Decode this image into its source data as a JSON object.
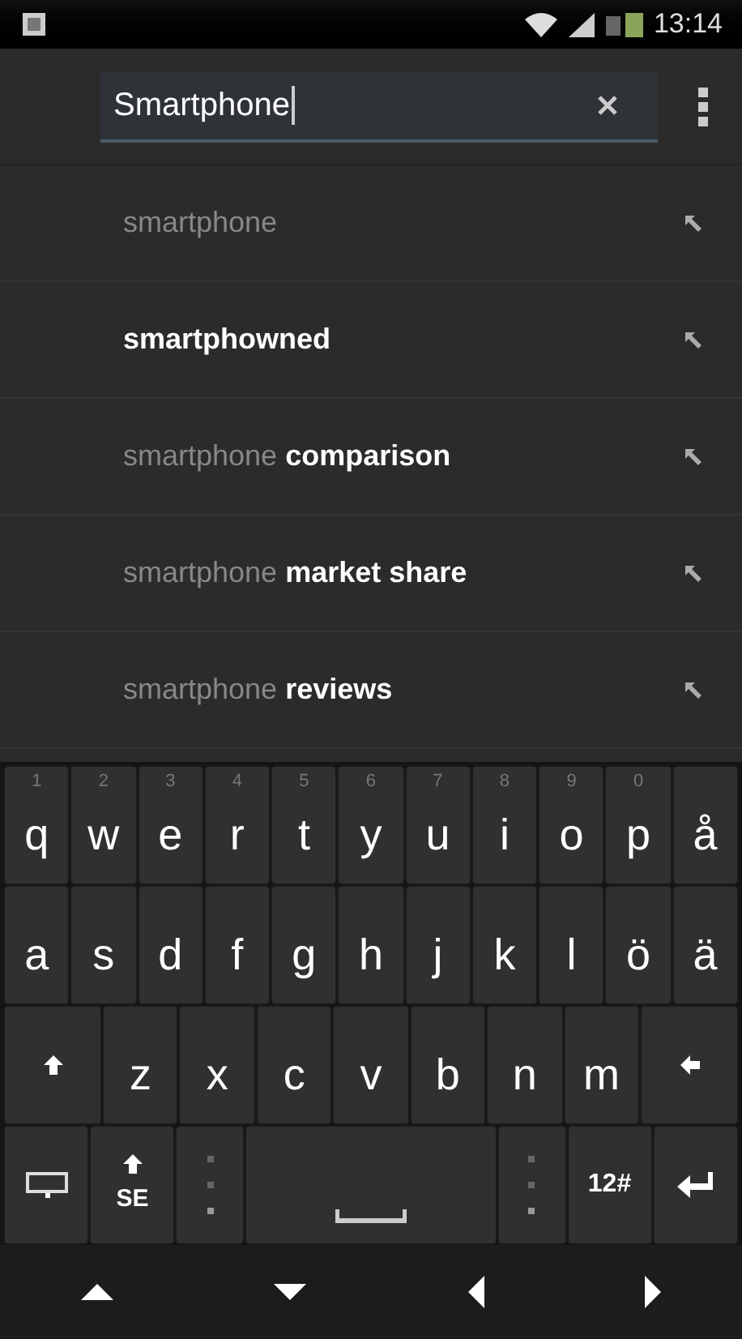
{
  "status_bar": {
    "time": "13:14"
  },
  "search": {
    "value": "Smartphone"
  },
  "suggestions": [
    {
      "text": "smartphone"
    },
    {
      "text": "**smartphowned**"
    },
    {
      "text": "smartphone **comparison**"
    },
    {
      "text": "smartphone **market share**"
    },
    {
      "text": "smartphone **reviews**"
    }
  ],
  "keyboard": {
    "top_row": [
      {
        "label": "q",
        "hint": "1"
      },
      {
        "label": "w",
        "hint": "2"
      },
      {
        "label": "e",
        "hint": "3"
      },
      {
        "label": "r",
        "hint": "4"
      },
      {
        "label": "t",
        "hint": "5"
      },
      {
        "label": "y",
        "hint": "6"
      },
      {
        "label": "u",
        "hint": "7"
      },
      {
        "label": "i",
        "hint": "8"
      },
      {
        "label": "o",
        "hint": "9"
      },
      {
        "label": "p",
        "hint": "0"
      },
      {
        "label": "å"
      }
    ],
    "home_row": [
      {
        "label": "a"
      },
      {
        "label": "s"
      },
      {
        "label": "d"
      },
      {
        "label": "f"
      },
      {
        "label": "g"
      },
      {
        "label": "h"
      },
      {
        "label": "j"
      },
      {
        "label": "k"
      },
      {
        "label": "l"
      },
      {
        "label": "ö"
      },
      {
        "label": "ä"
      }
    ],
    "bottom_row": [
      {
        "kind": "shift"
      },
      {
        "label": "z"
      },
      {
        "label": "x"
      },
      {
        "label": "c"
      },
      {
        "label": "v"
      },
      {
        "label": "b"
      },
      {
        "label": "n"
      },
      {
        "label": "m"
      },
      {
        "kind": "backspace"
      }
    ],
    "function_row": [
      {
        "kind": "keyboard"
      },
      {
        "kind": "language",
        "label": "SE"
      },
      {
        "kind": "punct"
      },
      {
        "kind": "space"
      },
      {
        "kind": "punct"
      },
      {
        "kind": "symbols",
        "label": "12#"
      },
      {
        "kind": "enter"
      }
    ]
  }
}
